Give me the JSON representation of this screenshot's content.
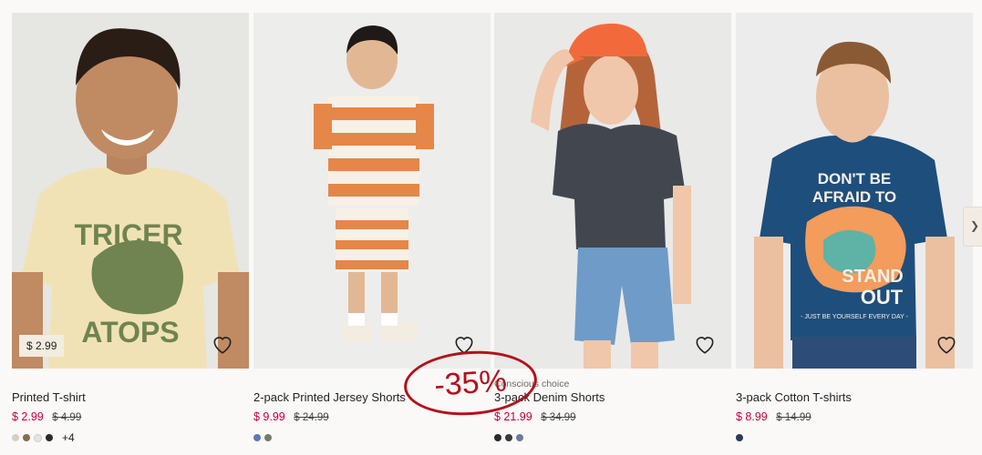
{
  "products": [
    {
      "title": "Printed T-shirt",
      "price": "$ 2.99",
      "old_price": "$ 4.99",
      "price_tag": "$ 2.99",
      "swatches": [
        "#d8cfc2",
        "#8a6a4a",
        "#e9e4dc",
        "#2b2b2b"
      ],
      "more_colors": "+4",
      "photo_bg": "#ececea",
      "shirt_color": "#f1e2b6",
      "graphic_color": "#6f8450",
      "image_text_top": "TRICER",
      "image_text_bottom": "ATOPS"
    },
    {
      "title": "2-pack Printed Jersey Shorts",
      "price": "$ 9.99",
      "old_price": "$ 24.99",
      "swatches": [
        "#5d78b4",
        "#6f7f68"
      ],
      "photo_bg": "#ededec",
      "shirt_color": "#e58748"
    },
    {
      "title": "3-pack Denim Shorts",
      "price": "$ 21.99",
      "old_price": "$ 34.99",
      "badge": "Conscious choice",
      "swatches": [
        "#2a2a2a",
        "#3a3a3a",
        "#6f7a9a"
      ],
      "photo_bg": "#e9e9e8",
      "shirt_color": "#42474f",
      "cap_color": "#f26a3c"
    },
    {
      "title": "3-pack Cotton T-shirts",
      "price": "$ 8.99",
      "old_price": "$ 14.99",
      "swatches": [
        "#2b3a5c"
      ],
      "photo_bg": "#ececec",
      "shirt_color": "#1e4e7c",
      "image_text_lines": [
        "DON'T BE",
        "AFRAID TO",
        "STAND",
        "OUT"
      ],
      "image_text_small": "- JUST BE YOURSELF EVERY DAY -"
    }
  ],
  "discount_stamp": "-35%",
  "colors": {
    "sale_price": "#c4003a",
    "stamp": "#b3121b",
    "page_bg": "#faf9f8"
  }
}
